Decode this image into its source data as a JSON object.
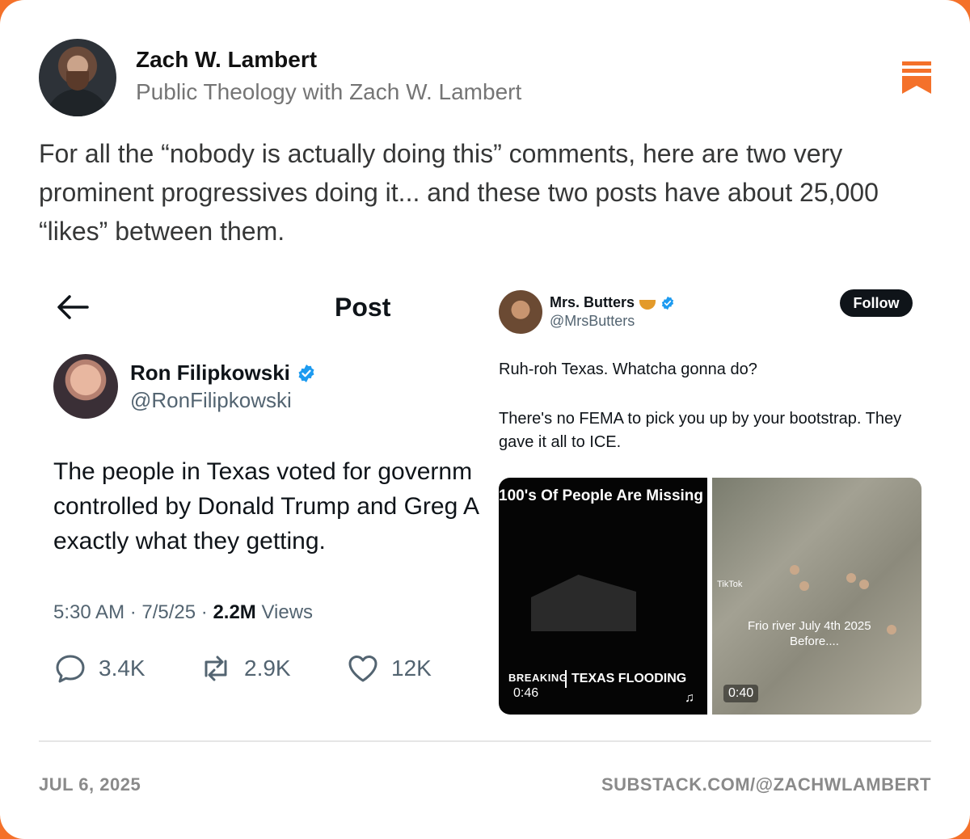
{
  "note": {
    "author": "Zach W. Lambert",
    "publication": "Public Theology with Zach W. Lambert",
    "text": "For all the “nobody is actually doing this” comments, here are two very prominent progressives doing it... and these two posts have about 25,000 “likes” between them.",
    "date": "JUL 6, 2025",
    "url": "SUBSTACK.COM/@ZACHWLAMBERT",
    "accent_color": "#f4712a"
  },
  "left_post": {
    "heading": "Post",
    "name": "Ron Filipkowski",
    "handle": "@RonFilipkowski",
    "text_lines": [
      "The people in Texas voted for governm",
      "controlled by Donald Trump and Greg A",
      "exactly what they getting."
    ],
    "meta_prefix": "5:30 AM · 7/5/25 · ",
    "views_count": "2.2M",
    "views_label": " Views",
    "replies": "3.4K",
    "reposts": "2.9K",
    "likes": "12K"
  },
  "right_post": {
    "name": "Mrs. Butters",
    "handle": "@MrsButters",
    "follow_label": "Follow",
    "text1": "Ruh-roh Texas. Whatcha gonna do?",
    "text2": "There's no FEMA to pick you up by your bootstrap. They gave it all to ICE.",
    "media1": {
      "headline": "100's Of People Are Missing",
      "breaking": "BREAKING",
      "flood": "TEXAS FLOODING",
      "duration": "0:46",
      "watermark": "TikTok"
    },
    "media2": {
      "watermark": "TikTok",
      "caption1": "Frio river July 4th 2025",
      "caption2": "Before....",
      "duration": "0:40"
    }
  }
}
